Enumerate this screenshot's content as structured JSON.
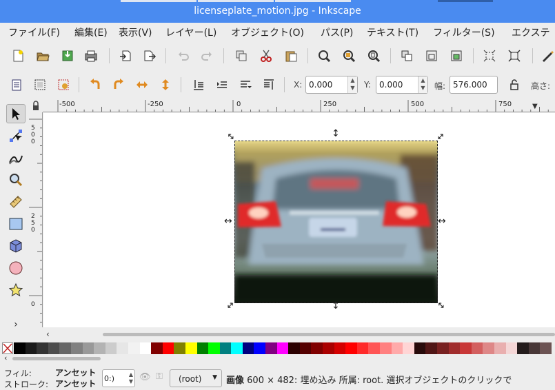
{
  "window": {
    "title": "licenseplate_motion.jpg - Inkscape"
  },
  "menu": [
    "ファイル(F)",
    "編集(E)",
    "表示(V)",
    "レイヤー(L)",
    "オブジェクト(O)",
    "パス(P)",
    "テキスト(T)",
    "フィルター(S)",
    "エクステ"
  ],
  "commands": {
    "icons": [
      "new-document-icon",
      "open-icon",
      "save-icon",
      "print-icon",
      "import-icon",
      "export-icon",
      "undo-icon",
      "redo-icon",
      "duplicate-icon",
      "cut-icon",
      "paste-icon",
      "zoom-selection-icon",
      "zoom-drawing-icon",
      "zoom-page-icon",
      "group-icon",
      "ungroup-icon",
      "clone-icon",
      "node-align-icon",
      "snap-icon",
      "pen-icon"
    ]
  },
  "controls": {
    "x_label": "X:",
    "x_value": "0.000",
    "y_label": "Y:",
    "y_value": "0.000",
    "w_label": "幅:",
    "w_value": "576.000",
    "h_label": "高さ:"
  },
  "ruler": {
    "h_ticks": [
      "-500",
      "-250",
      "0",
      "250",
      "500",
      "750"
    ],
    "v_labels": [
      "5\n0\n0",
      "2\n5\n0",
      "0"
    ]
  },
  "tools": [
    "selector-arrow-icon",
    "node-tool-icon",
    "tweak-tool-icon",
    "zoom-tool-icon",
    "measure-tool-icon",
    "rectangle-tool-icon",
    "3d-box-tool-icon",
    "circle-tool-icon",
    "star-tool-icon",
    "expand-tools-chevron-icon"
  ],
  "palette": {
    "colors": [
      "#000000",
      "#1a1a1a",
      "#333333",
      "#4d4d4d",
      "#666666",
      "#808080",
      "#999999",
      "#b3b3b3",
      "#cccccc",
      "#e6e6e6",
      "#f2f2f2",
      "#ffffff",
      "#800000",
      "#ff0000",
      "#808000",
      "#ffff00",
      "#008000",
      "#00ff00",
      "#008080",
      "#00ffff",
      "#000080",
      "#0000ff",
      "#800080",
      "#ff00ff",
      "#2b0000",
      "#550000",
      "#800000",
      "#aa0000",
      "#d40000",
      "#ff0000",
      "#ff2a2a",
      "#ff5555",
      "#ff8080",
      "#ffaaaa",
      "#ffd5d5",
      "#280b0b",
      "#501616",
      "#782121",
      "#a02c2c",
      "#c83737",
      "#d35f5f",
      "#de8787",
      "#e9afaf",
      "#f4d7d7",
      "#241c1c",
      "#483737",
      "#6c5353"
    ]
  },
  "status": {
    "fill_label": "フィル:",
    "fill_value": "アンセット",
    "stroke_label": "ストローク:",
    "stroke_value": "アンセット",
    "opacity_value": "0:)",
    "layer_value": "(root)",
    "message_bold": "画像",
    "message": " 600 × 482: 埋め込み 所属: root. 選択オブジェクトのクリックで"
  }
}
